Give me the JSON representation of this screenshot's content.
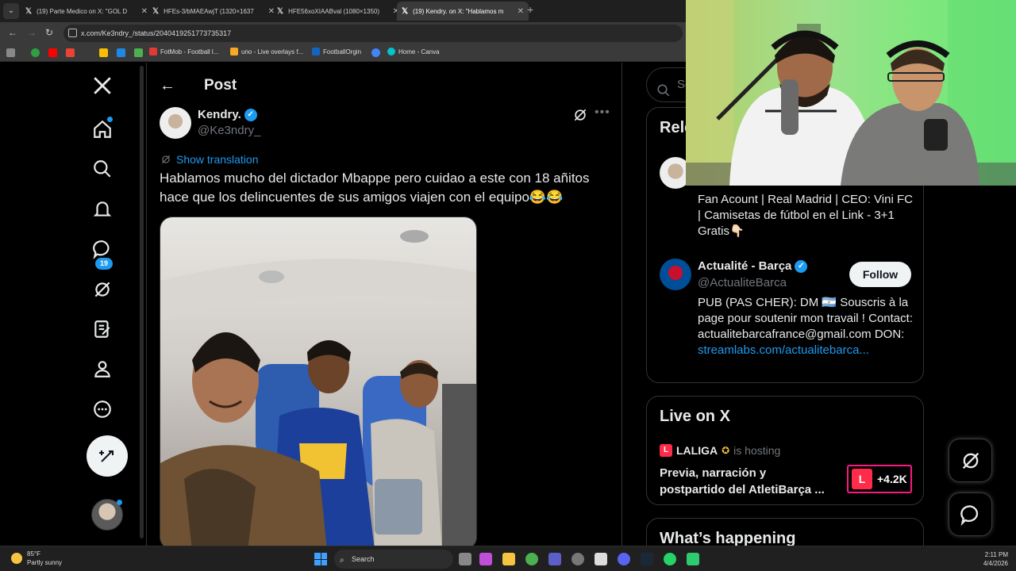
{
  "browser": {
    "tabs": [
      {
        "title": "(19) Parte Medico on X: \"GOL D",
        "active": false
      },
      {
        "title": "HFEs-3/bMAEAwjT (1320×1637",
        "active": false
      },
      {
        "title": "HFE56xoXIAABval (1080×1350)",
        "active": false
      },
      {
        "title": "(19) Kendry. on X: \"Hablamos m",
        "active": true
      }
    ],
    "url": "x.com/Ke3ndry_/status/2040419251773735317",
    "bookmarks": [
      "FotMob - Football l...",
      "uno - Live overlays f...",
      "FootballOrgin",
      "Home - Canva"
    ]
  },
  "nav": {
    "notifications_count": "19"
  },
  "post": {
    "header_title": "Post",
    "author_name": "Kendry.",
    "author_handle": "@Ke3ndry_",
    "show_translation": "Show translation",
    "text": "Hablamos mucho del dictador Mbappe pero cuidao a este con 18 añitos hace que los delincuentes de sus amigos viajen con el equipo😂😂"
  },
  "sidebar": {
    "search_placeholder": "Se",
    "relevant_title": "Rele",
    "relevant_people": [
      {
        "bio": "Fan Acount | Real Madrid | CEO: Vini FC | Camisetas de fútbol en el Link - 3+1 Gratis👇🏻"
      },
      {
        "name": "Actualité - Barça",
        "handle": "@ActualiteBarca",
        "follow_label": "Follow",
        "bio": "PUB (PAS CHER): DM 🇦🇷 Souscris à la page pour soutenir mon travail ! Contact: actualitebarcafrance@gmail.com DON:",
        "link": "streamlabs.com/actualitebarca..."
      }
    ],
    "live": {
      "title": "Live on X",
      "host": "LALIGA",
      "host_suffix": "is hosting",
      "stream_title": "Previa, narración y postpartido del AtletiBarça ...",
      "viewers": "+4.2K"
    },
    "whats_happening": "What’s happening"
  },
  "taskbar": {
    "temp": "85°F",
    "weather": "Partly sunny",
    "search": "Search",
    "time": "2:11 PM",
    "date": "4/4/2026"
  },
  "colors": {
    "accent": "#1d9bf0",
    "live_border": "#f91880",
    "webcam_green": "#7fe87e"
  }
}
